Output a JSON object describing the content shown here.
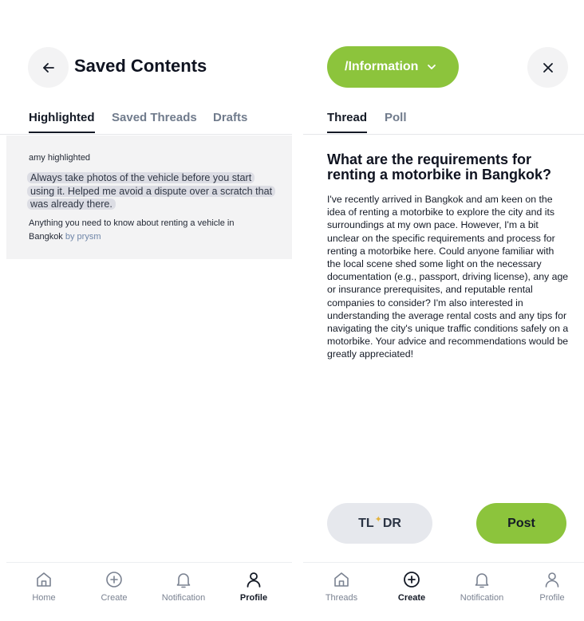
{
  "left": {
    "header": {
      "title": "Saved Contents"
    },
    "tabs": [
      {
        "label": "Highlighted",
        "active": true
      },
      {
        "label": "Saved Threads",
        "active": false
      },
      {
        "label": "Drafts",
        "active": false
      }
    ],
    "highlight": {
      "author": "amy highlighted",
      "quote": "Always take photos of the vehicle before you start using it. Helped me avoid a dispute over a scratch that was already there.",
      "source_text": "Anything you need to know about renting a vehicle in Bangkok",
      "source_by": "by prysm"
    },
    "nav": [
      {
        "label": "Home",
        "icon": "home-icon",
        "active": false
      },
      {
        "label": "Create",
        "icon": "plus-circle-icon",
        "active": false
      },
      {
        "label": "Notification",
        "icon": "bell-icon",
        "active": false
      },
      {
        "label": "Profile",
        "icon": "user-icon",
        "active": true
      }
    ]
  },
  "right": {
    "category": "/Information",
    "tabs": [
      {
        "label": "Thread",
        "active": true
      },
      {
        "label": "Poll",
        "active": false
      }
    ],
    "post": {
      "title": "What are the requirements for renting a motorbike in Bangkok?",
      "body": "I've recently arrived in Bangkok and am keen on the idea of renting a motorbike to explore the city and its surroundings at my own pace. However, I'm a bit unclear on the specific requirements and process for renting a motorbike here. Could anyone familiar with the local scene shed some light on the necessary documentation (e.g., passport, driving license), any age or insurance prerequisites, and reputable rental companies to consider? I'm also interested in understanding the average rental costs and any tips for navigating the city's unique traffic conditions safely on a motorbike. Your advice and recommendations would be greatly appreciated!"
    },
    "actions": {
      "tldr_left": "TL",
      "tldr_right": "DR",
      "post": "Post"
    },
    "nav": [
      {
        "label": "Threads",
        "icon": "home-icon",
        "active": false
      },
      {
        "label": "Create",
        "icon": "plus-circle-icon",
        "active": true
      },
      {
        "label": "Notification",
        "icon": "bell-icon",
        "active": false
      },
      {
        "label": "Profile",
        "icon": "user-icon",
        "active": false
      }
    ]
  },
  "colors": {
    "accent": "#8cc43c",
    "text": "#141a26",
    "muted": "#707b8c",
    "surface": "#f3f3f4"
  }
}
